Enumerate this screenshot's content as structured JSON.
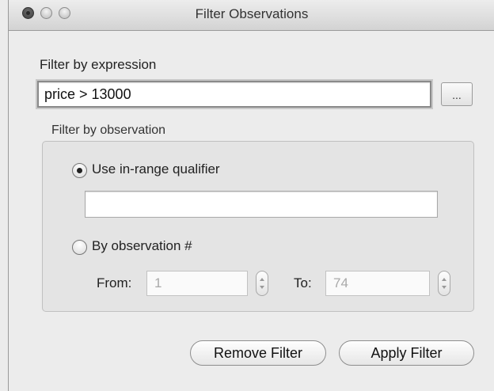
{
  "window": {
    "title": "Filter Observations"
  },
  "expression": {
    "label": "Filter by expression",
    "value": "price > 13000",
    "browse_label": "..."
  },
  "observation": {
    "group_label": "Filter by observation",
    "in_range": {
      "label": "Use in-range qualifier",
      "selected": true,
      "value": ""
    },
    "by_number": {
      "label": "By observation #",
      "selected": false,
      "from_label": "From:",
      "from_value": "1",
      "to_label": "To:",
      "to_value": "74"
    }
  },
  "buttons": {
    "remove": "Remove Filter",
    "apply": "Apply Filter"
  }
}
